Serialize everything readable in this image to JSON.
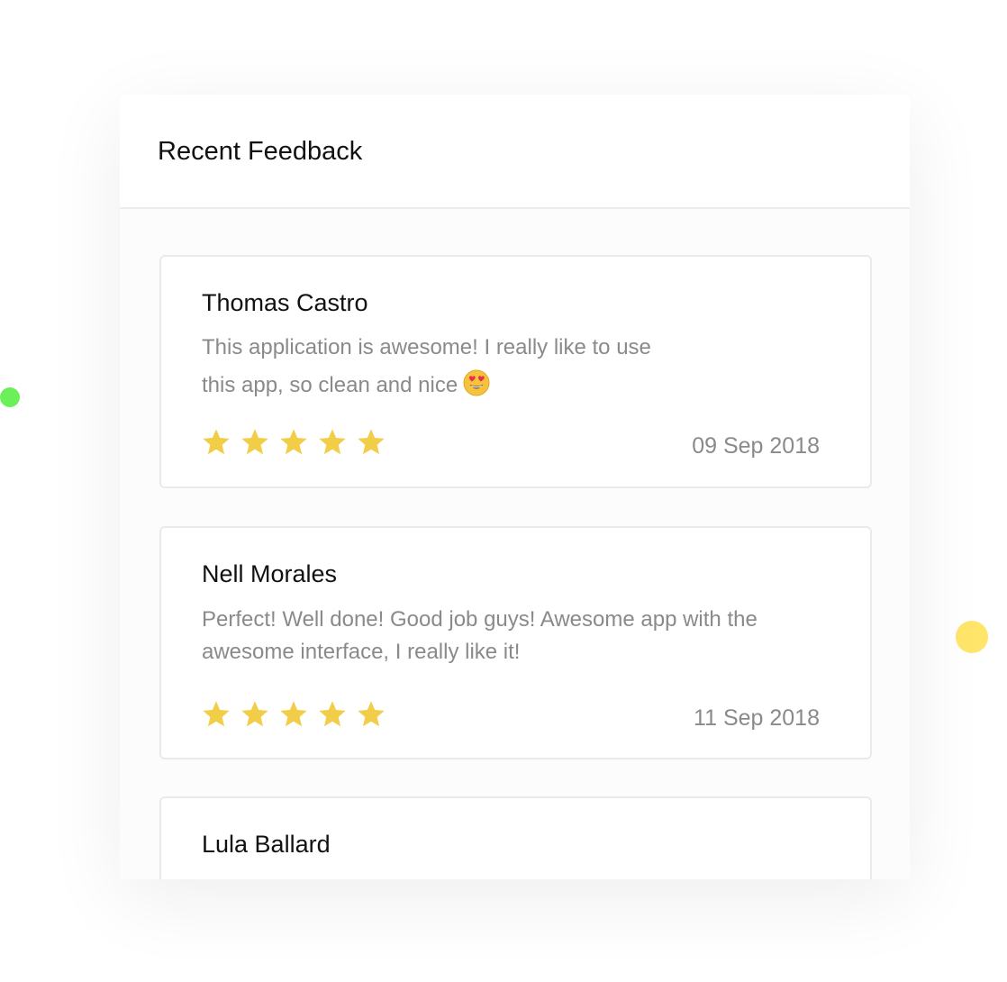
{
  "feedback": {
    "title": "Recent Feedback",
    "reviews": [
      {
        "name": "Thomas Castro",
        "comment": "This application is awesome! I really like to use this app, so clean and nice",
        "emoji": "smiling-face-with-heart-eyes-icon",
        "rating": 5,
        "date": "09 Sep 2018"
      },
      {
        "name": "Nell Morales",
        "comment": "Perfect! Well done! Good job guys! Awesome app with the awesome interface, I really like it!",
        "rating": 5,
        "date": "11 Sep 2018"
      },
      {
        "name": "Lula Ballard"
      }
    ]
  },
  "colors": {
    "star": "#f2cd48",
    "accent_green": "#6cf05a",
    "accent_yellow": "#ffe569",
    "muted_text": "#8a8a8a"
  }
}
